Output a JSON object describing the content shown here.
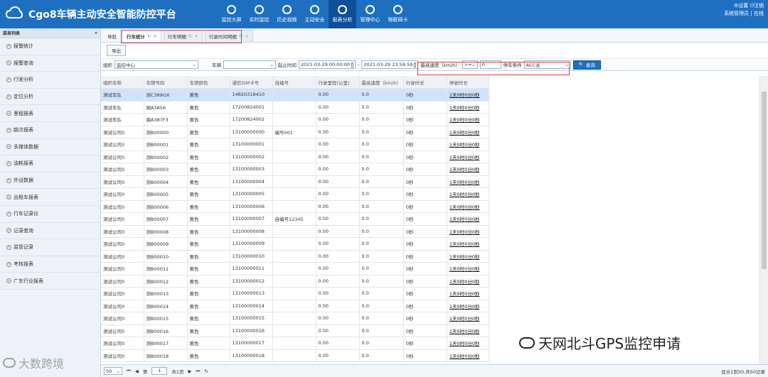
{
  "header": {
    "title": "Cgo8车辆主动安全智能防控平台",
    "nav": [
      {
        "label": "监控大屏",
        "icon": "monitor-icon"
      },
      {
        "label": "实时监控",
        "icon": "location-icon"
      },
      {
        "label": "历史视频",
        "icon": "video-icon"
      },
      {
        "label": "主动安全",
        "icon": "shield-icon"
      },
      {
        "label": "报表分析",
        "icon": "report-icon"
      },
      {
        "label": "管理中心",
        "icon": "gear-icon"
      },
      {
        "label": "物联网卡",
        "icon": "sim-card-icon"
      }
    ],
    "settings_label": "设置",
    "logout_label": "注销",
    "user_label": "系统管理员",
    "status_label": "在线"
  },
  "sidebar": {
    "title": "菜单列表",
    "collapse": "«",
    "items": [
      "报警统计",
      "报警查询",
      "行驶分析",
      "定位分析",
      "里程报表",
      "趟次报表",
      "多媒体数据",
      "油耗报表",
      "外设数据",
      "出租车报表",
      "行车记录仪",
      "记录查询",
      "监管记录",
      "考核报表",
      "广东行业报表"
    ]
  },
  "tabs": [
    {
      "label": "导航"
    },
    {
      "label": "行车统计"
    },
    {
      "label": "行车明细"
    },
    {
      "label": "行驶时间明细"
    }
  ],
  "toolbar": {
    "export_label": "导出"
  },
  "filters": {
    "org_label": "组织",
    "org_value": "监控中心",
    "vehicle_label": "车辆",
    "vehicle_value": "",
    "time_label": "起止时间",
    "start": "2021-03-29 00:00:00",
    "sep": "-",
    "end": "2021-03-29 23:59:59",
    "speed_label": "最高速度（km/h）",
    "operator": ">=",
    "speed_value": "0",
    "park_label": "停车条件",
    "park_value": "ACC关",
    "query_label": "查询"
  },
  "table": {
    "columns": [
      "组织名称",
      "车牌号码",
      "车牌颜色",
      "通信SIM卡号",
      "自编号",
      "行驶里程(公里)",
      "最高速度（km/h）",
      "行驶时长",
      "停驶时长"
    ],
    "rows": [
      [
        "测试车队",
        "测C389GX",
        "黄色",
        "14820318410",
        "",
        "0.00",
        "0.0",
        "0秒",
        "1天0时0分0秒"
      ],
      [
        "测试车队",
        "闽A3856",
        "黄色",
        "17200824001",
        "",
        "0.00",
        "0.0",
        "0秒",
        "1天0时0分0秒"
      ],
      [
        "测试车队",
        "闽A387F3",
        "黄色",
        "17200824002",
        "",
        "0.00",
        "0.0",
        "0秒",
        "1天0时0分0秒"
      ],
      [
        "测试公司0",
        "测B00000",
        "黄色",
        "13100000000",
        "编号001",
        "0.00",
        "0.0",
        "0秒",
        "1天0时0分0秒"
      ],
      [
        "测试公司0",
        "测B00001",
        "黄色",
        "13100000001",
        "",
        "0.00",
        "0.0",
        "0秒",
        "1天0时0分0秒"
      ],
      [
        "测试公司0",
        "测B00002",
        "黄色",
        "13100000002",
        "",
        "0.00",
        "0.0",
        "0秒",
        "1天0时0分0秒"
      ],
      [
        "测试公司0",
        "测B00003",
        "黄色",
        "13100000003",
        "",
        "0.00",
        "0.0",
        "0秒",
        "1天0时0分0秒"
      ],
      [
        "测试公司0",
        "测B00004",
        "黄色",
        "13100000004",
        "",
        "0.00",
        "0.0",
        "0秒",
        "1天0时0分0秒"
      ],
      [
        "测试公司0",
        "测B00005",
        "黄色",
        "13100000005",
        "",
        "0.00",
        "0.0",
        "0秒",
        "1天0时0分0秒"
      ],
      [
        "测试公司0",
        "测B00006",
        "黄色",
        "13100000006",
        "",
        "0.00",
        "0.0",
        "0秒",
        "1天0时0分0秒"
      ],
      [
        "测试公司0",
        "测B00007",
        "黄色",
        "13100000007",
        "自编号12345",
        "0.00",
        "0.0",
        "0秒",
        "1天0时0分0秒"
      ],
      [
        "测试公司0",
        "测B00008",
        "黄色",
        "13100000008",
        "",
        "0.00",
        "0.0",
        "0秒",
        "1天0时0分0秒"
      ],
      [
        "测试公司0",
        "测B00009",
        "黄色",
        "13100000009",
        "",
        "0.00",
        "0.0",
        "0秒",
        "1天0时0分0秒"
      ],
      [
        "测试公司0",
        "测B00010",
        "黄色",
        "13100000010",
        "",
        "0.00",
        "0.0",
        "0秒",
        "1天0时0分0秒"
      ],
      [
        "测试公司0",
        "测B00011",
        "黄色",
        "13100000011",
        "",
        "0.00",
        "0.0",
        "0秒",
        "1天0时0分0秒"
      ],
      [
        "测试公司0",
        "测B00012",
        "黄色",
        "13100000012",
        "",
        "0.00",
        "0.0",
        "0秒",
        "1天0时0分0秒"
      ],
      [
        "测试公司0",
        "测B00013",
        "黄色",
        "13100000013",
        "",
        "0.00",
        "0.0",
        "0秒",
        "1天0时0分0秒"
      ],
      [
        "测试公司0",
        "测B00014",
        "黄色",
        "13100000014",
        "",
        "0.00",
        "0.0",
        "0秒",
        "1天0时0分0秒"
      ],
      [
        "测试公司0",
        "测B00015",
        "黄色",
        "13100000015",
        "",
        "0.00",
        "0.0",
        "0秒",
        "1天0时0分0秒"
      ],
      [
        "测试公司0",
        "测B00016",
        "黄色",
        "13100000016",
        "",
        "0.00",
        "0.0",
        "0秒",
        "1天0时0分0秒"
      ],
      [
        "测试公司0",
        "测B00017",
        "黄色",
        "13100000017",
        "",
        "0.00",
        "0.0",
        "0秒",
        "1天0时0分0秒"
      ],
      [
        "测试公司0",
        "测B00018",
        "黄色",
        "13100000018",
        "",
        "0.00",
        "0.0",
        "0秒",
        "1天0时0分0秒"
      ]
    ]
  },
  "pager": {
    "page_size": "50",
    "page_label": "第",
    "page_value": "1",
    "total_pages": "共1页",
    "info": "显示1到50,共50记录"
  },
  "watermark": {
    "text": "天网北斗GPS监控申请"
  },
  "watermark2": {
    "text": "大数跨境"
  },
  "colors": {
    "header_bg": "#1e6fc0",
    "highlight": "#d63c3c",
    "selected_row": "#cfe4fa"
  }
}
